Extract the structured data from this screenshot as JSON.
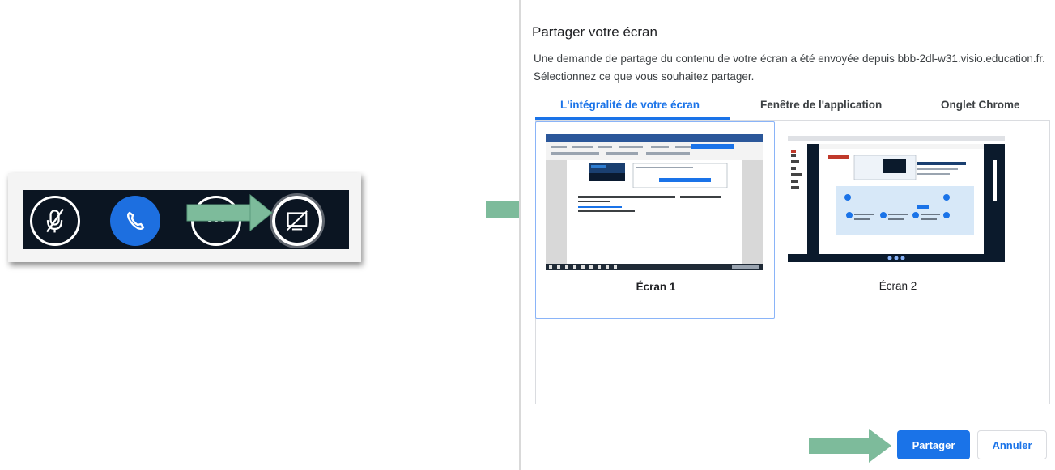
{
  "dialog": {
    "title": "Partager votre écran",
    "description_line1": "Une demande de partage du contenu de votre écran a été envoyée depuis bbb-2dl-w31.visio.education.fr.",
    "description_line2": "Sélectionnez ce que vous souhaitez partager.",
    "tabs": [
      {
        "label": "L'intégralité de votre écran",
        "active": true
      },
      {
        "label": "Fenêtre de l'application",
        "active": false
      },
      {
        "label": "Onglet Chrome",
        "active": false
      }
    ],
    "screens": [
      {
        "label": "Écran 1",
        "selected": true
      },
      {
        "label": "Écran 2",
        "selected": false
      }
    ],
    "share_button": "Partager",
    "cancel_button": "Annuler"
  },
  "toolbar": {
    "buttons": [
      "microphone-muted",
      "phone",
      "more-options",
      "screen-share"
    ]
  },
  "colors": {
    "accent": "#1a73e8",
    "arrow": "#7dbb9b",
    "toolbar_bg": "#0b1522",
    "phone_button": "#1d6fe0"
  }
}
